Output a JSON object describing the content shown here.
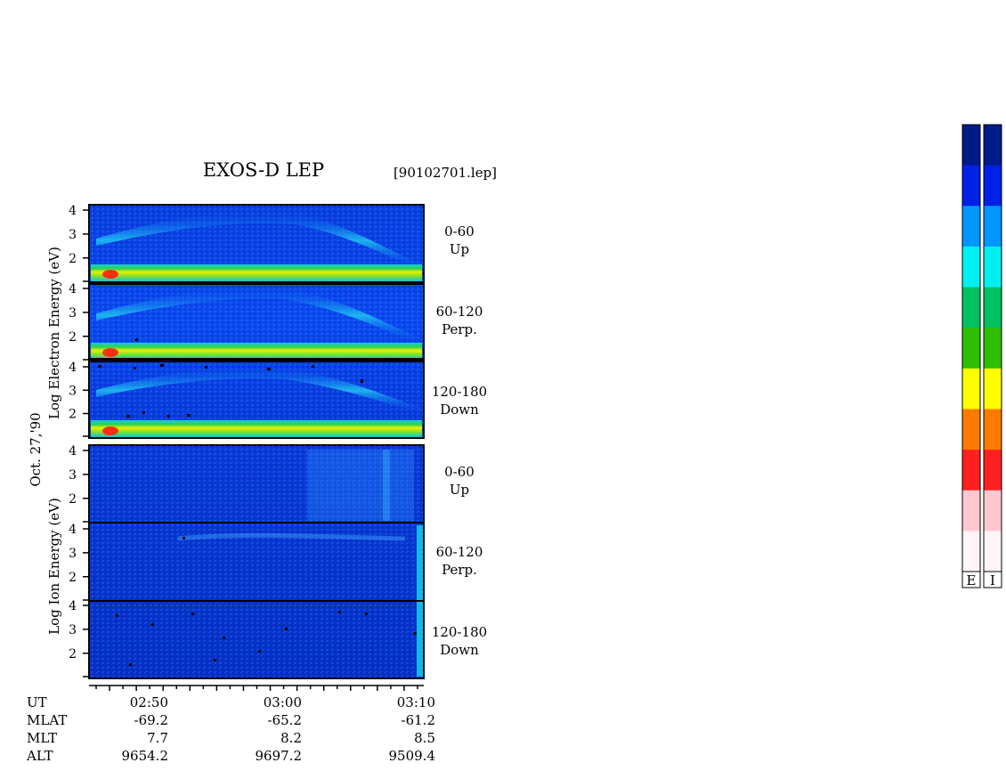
{
  "title": "EXOS-D LEP",
  "file_label": "[90102701.lep]",
  "date_label": "Oct. 27,'90",
  "electron_ylabel": "Log  Electron  Energy (eV)",
  "ion_ylabel": "Log  Ion  Energy (eV)",
  "colorbar_labels": [
    "E",
    "I"
  ],
  "colors": {
    "scale": [
      "#fff4f6",
      "#ffc8d0",
      "#ff2020",
      "#ff7a00",
      "#ffff00",
      "#2ec000",
      "#00c060",
      "#00f0f0",
      "#0096ff",
      "#0020e6",
      "#001a8a"
    ]
  },
  "chart_data": {
    "type": "heatmap",
    "x": {
      "axis_label": "UT",
      "ticks": [
        "02:50",
        "03:00",
        "03:10"
      ]
    },
    "y": {
      "ticks": [
        "4",
        "3",
        "2"
      ]
    },
    "footer": {
      "rows": [
        {
          "label": "UT",
          "values": [
            "02:50",
            "03:00",
            "03:10"
          ]
        },
        {
          "label": "MLAT",
          "values": [
            "-69.2",
            "-65.2",
            "-61.2"
          ]
        },
        {
          "label": "MLT",
          "values": [
            "7.7",
            "8.2",
            "8.5"
          ]
        },
        {
          "label": "ALT",
          "values": [
            "9654.2",
            "9697.2",
            "9509.4"
          ]
        }
      ]
    },
    "panels": [
      {
        "species": "Electron",
        "range": "0-60",
        "dir": "Up"
      },
      {
        "species": "Electron",
        "range": "60-120",
        "dir": "Perp."
      },
      {
        "species": "Electron",
        "range": "120-180",
        "dir": "Down"
      },
      {
        "species": "Ion",
        "range": "0-60",
        "dir": "Up"
      },
      {
        "species": "Ion",
        "range": "60-120",
        "dir": "Perp."
      },
      {
        "species": "Ion",
        "range": "120-180",
        "dir": "Down"
      }
    ]
  }
}
